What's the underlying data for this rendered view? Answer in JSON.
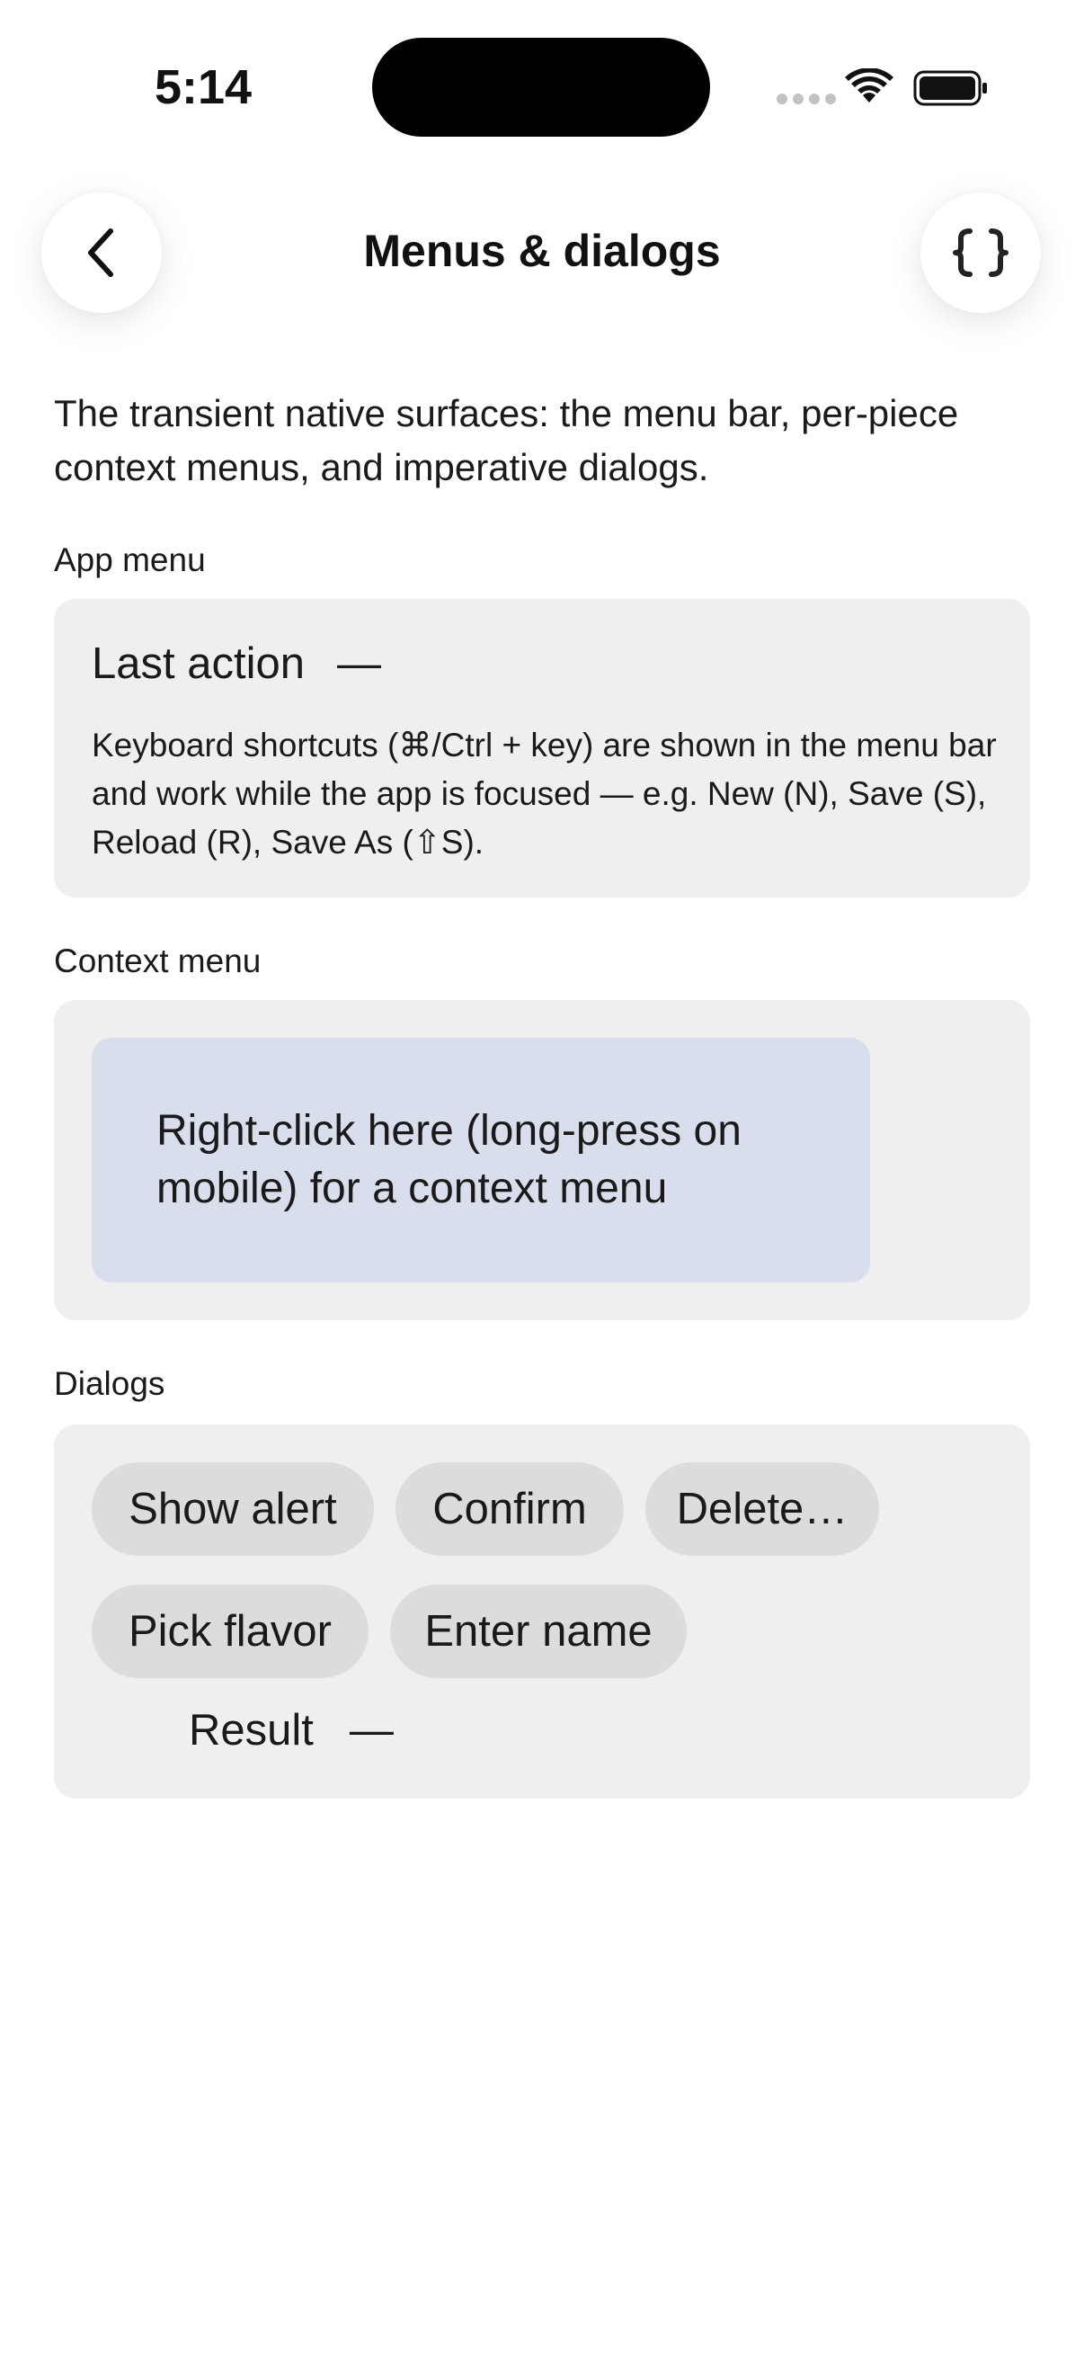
{
  "status_bar": {
    "time": "5:14",
    "icons": [
      "cellular-dots-icon",
      "wifi-icon",
      "battery-icon"
    ]
  },
  "header": {
    "title": "Menus & dialogs",
    "back_icon": "chevron-left-icon",
    "source_icon": "curly-braces-icon",
    "source_glyph": "{}"
  },
  "intro": "The transient native surfaces: the menu bar, per-piece context menus, and imperative dialogs.",
  "app_menu": {
    "section_label": "App menu",
    "last_action_label": "Last action",
    "last_action_value": "—",
    "help": "Keyboard shortcuts (⌘/Ctrl + key) are shown in the menu bar and work while the app is focused — e.g. New (N), Save (S), Reload (R), Save As (⇧S)."
  },
  "context_menu": {
    "section_label": "Context menu",
    "target_text": "Right-click here (long-press on mobile) for a context menu"
  },
  "dialogs": {
    "section_label": "Dialogs",
    "buttons": [
      "Show alert",
      "Confirm",
      "Delete…",
      "Pick flavor",
      "Enter name"
    ],
    "result_label": "Result",
    "result_value": "—"
  },
  "colors": {
    "card_background": "#efefef",
    "context_target_background": "#d8deec",
    "chip_background": "#dcdcdc"
  }
}
